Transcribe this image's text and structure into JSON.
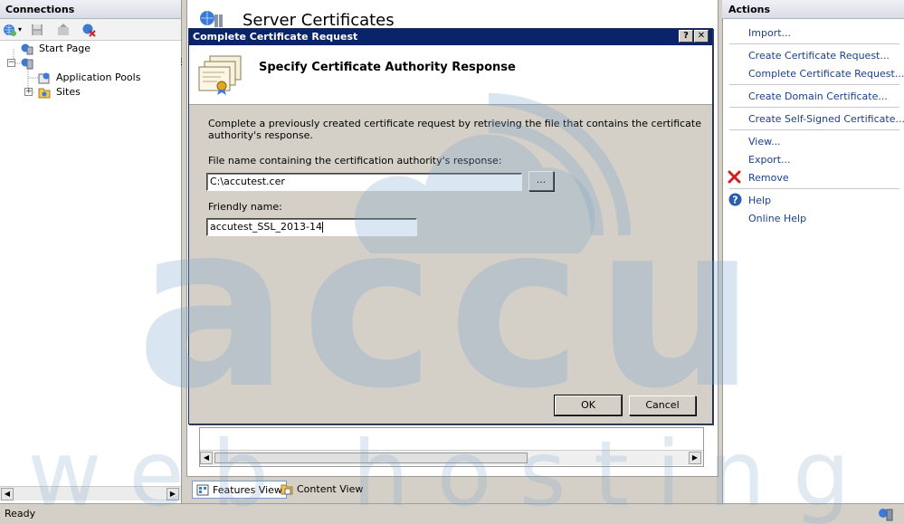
{
  "connections": {
    "header": "Connections",
    "tree": [
      {
        "label": "Start Page"
      },
      {
        "label": ""
      },
      {
        "label": "Application Pools"
      },
      {
        "label": "Sites"
      }
    ]
  },
  "center": {
    "title": "Server Certificates",
    "view_tabs": {
      "features": "Features View",
      "content": "Content View"
    }
  },
  "dialog": {
    "title": "Complete Certificate Request",
    "heading": "Specify Certificate Authority Response",
    "description_line1": "Complete a previously created certificate request by retrieving the file that contains the certificate",
    "description_line2": "authority's response.",
    "file_label": "File name containing the certification authority's response:",
    "file_value": "C:\\accutest.cer",
    "browse_label": "...",
    "friendly_label": "Friendly name:",
    "friendly_value": "accutest_SSL_2013-14",
    "ok_label": "OK",
    "cancel_label": "Cancel",
    "help_glyph": "?",
    "close_glyph": "✕"
  },
  "actions": {
    "header": "Actions",
    "items": [
      {
        "label": "Import..."
      },
      {
        "label": "Create Certificate Request..."
      },
      {
        "label": "Complete Certificate Request..."
      },
      {
        "label": "Create Domain Certificate..."
      },
      {
        "label": "Create Self-Signed Certificate..."
      },
      {
        "label": "View..."
      },
      {
        "label": "Export..."
      },
      {
        "label": "Remove"
      },
      {
        "label": "Help"
      },
      {
        "label": "Online Help"
      }
    ]
  },
  "status": {
    "text": "Ready"
  },
  "watermark": {
    "brand_top": "accu",
    "brand_bottom": "web hosting",
    "color": "#7ba4cc"
  },
  "colors": {
    "dialog_title_bg": "#0a246a",
    "link": "#1a3f8c",
    "remove_icon": "#d11f1f",
    "help_icon": "#2a5db0"
  }
}
